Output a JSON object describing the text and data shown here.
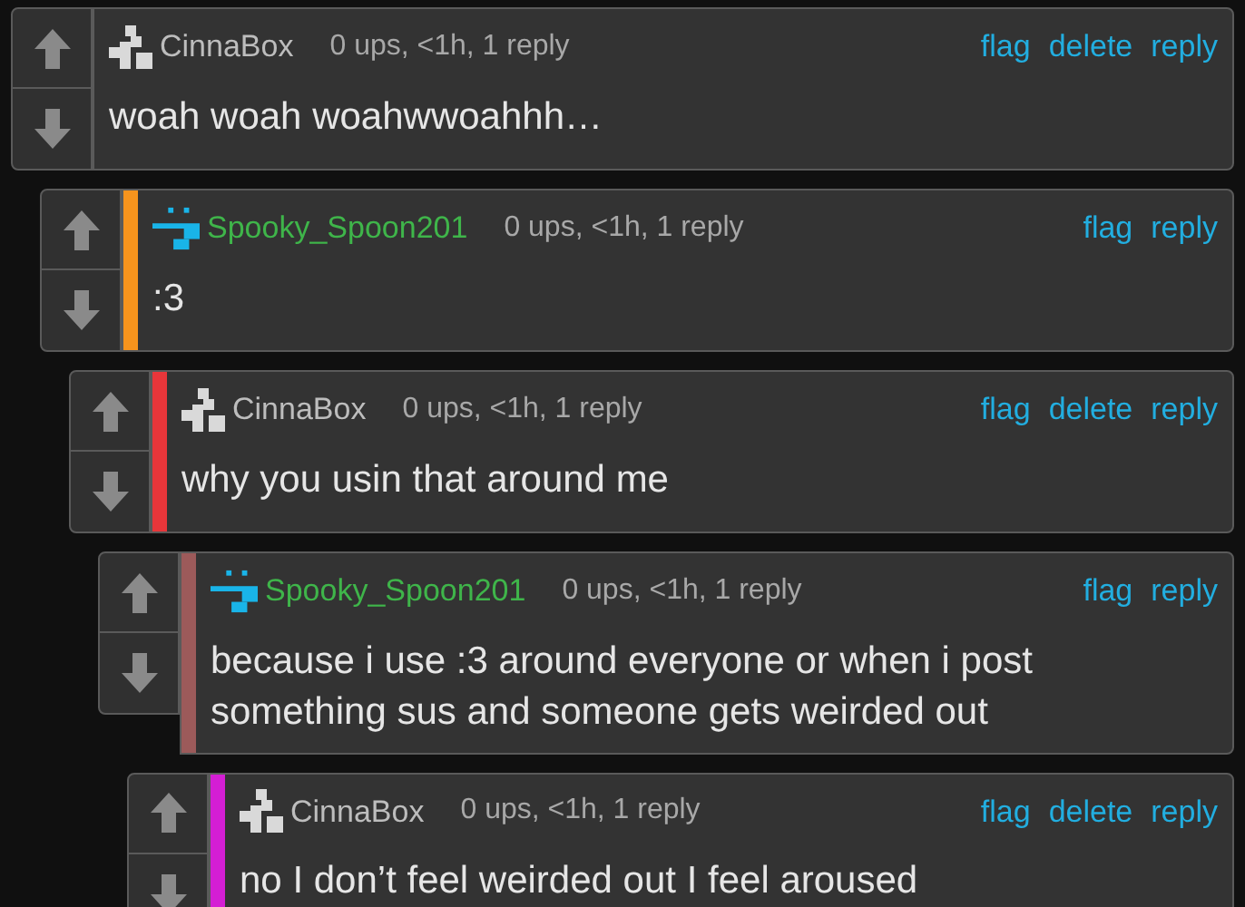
{
  "comments": [
    {
      "author": {
        "name": "CinnaBox",
        "color": "#bdbdbd"
      },
      "avatar": {
        "kind": "blocks",
        "color": "#d9d9d9"
      },
      "meta": "0 ups, <1h, 1 reply",
      "actions": [
        "flag",
        "delete",
        "reply"
      ],
      "body": "woah woah woahwwoahhh…",
      "children": [
        {
          "author": {
            "name": "Spooky_Spoon201",
            "color": "#3fb54a"
          },
          "avatar": {
            "kind": "face",
            "color": "#19b4e8"
          },
          "color": "#f7941d",
          "meta": "0 ups, <1h, 1 reply",
          "actions": [
            "flag",
            "reply"
          ],
          "body": ":3",
          "children": [
            {
              "author": {
                "name": "CinnaBox",
                "color": "#bdbdbd"
              },
              "avatar": {
                "kind": "blocks",
                "color": "#d9d9d9"
              },
              "color": "#e8363a",
              "meta": "0 ups, <1h, 1 reply",
              "actions": [
                "flag",
                "delete",
                "reply"
              ],
              "body": "why you usin that around me",
              "children": [
                {
                  "author": {
                    "name": "Spooky_Spoon201",
                    "color": "#3fb54a"
                  },
                  "avatar": {
                    "kind": "face",
                    "color": "#19b4e8"
                  },
                  "color": "#9c5a5a",
                  "meta": "0 ups, <1h, 1 reply",
                  "actions": [
                    "flag",
                    "reply"
                  ],
                  "body": "because i use :3 around everyone or when i post something sus and someone gets weirded out",
                  "children": [
                    {
                      "author": {
                        "name": "CinnaBox",
                        "color": "#bdbdbd"
                      },
                      "avatar": {
                        "kind": "blocks",
                        "color": "#d9d9d9"
                      },
                      "color": "#d41ed4",
                      "meta": "0 ups, <1h, 1 reply",
                      "actions": [
                        "flag",
                        "delete",
                        "reply"
                      ],
                      "body": "no I don’t feel weirded out I feel aroused"
                    }
                  ]
                }
              ]
            }
          ]
        }
      ]
    }
  ]
}
